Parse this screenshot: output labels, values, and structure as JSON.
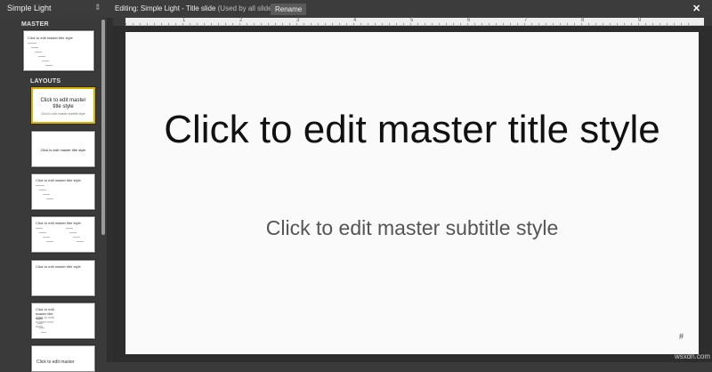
{
  "topbar": {
    "theme_name": "Simple Light",
    "menu_glyph": "⇕",
    "editing_label": "Editing: Simple Light - Title slide",
    "used_by": "(Used by all slides)",
    "rename_label": "Rename",
    "close_glyph": "✕"
  },
  "panel": {
    "master_label": "MASTER",
    "layouts_label": "LAYOUTS",
    "master_thumb": {
      "title": "Click to edit master title style"
    },
    "layouts": [
      {
        "title": "Click to edit master title style",
        "subtitle": "Click to edit master subtitle style",
        "selected": true
      },
      {
        "title": "Click to edit master title style"
      },
      {
        "title": "Click to edit master title style"
      },
      {
        "title": "Click to edit master title style"
      },
      {
        "title": "Click to edit master title style"
      },
      {
        "title": "Click to edit master title style",
        "subtitle": "Click to edit master text style"
      },
      {
        "title": "Click to edit master"
      }
    ]
  },
  "ruler": {
    "numbers": [
      "1",
      "2",
      "3",
      "4",
      "5",
      "6",
      "7",
      "8",
      "9"
    ]
  },
  "slide": {
    "title": "Click to edit master title style",
    "subtitle": "Click to edit master subtitle style",
    "number_placeholder": "#"
  },
  "watermark": "wsxdn.com",
  "colors": {
    "selected_border": "#d8b400",
    "canvas": "#fafafa",
    "chrome": "#3c3c3c"
  }
}
